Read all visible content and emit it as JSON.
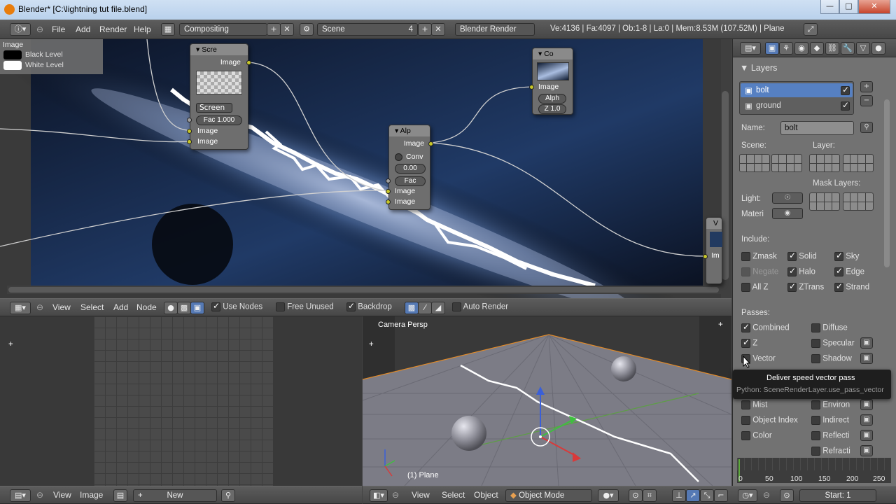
{
  "window": {
    "title": "Blender* [C:\\lightning tut file.blend]",
    "minimize": "—",
    "maximize": "□",
    "close": "✕"
  },
  "info_header": {
    "menus": [
      "File",
      "Add",
      "Render",
      "Help"
    ],
    "screen_layout": "Compositing",
    "scene": "Scene",
    "scene_users": "4",
    "render_engine": "Blender Render",
    "stats": "Ve:4136 | Fa:4097 | Ob:1-8 | La:0 | Mem:8.53M (107.52M) | Plane"
  },
  "node_editor": {
    "legend": {
      "title": "Image",
      "black_level": "Black Level",
      "white_level": "White Level"
    },
    "screen_node": {
      "title": "Scre",
      "output": "Image",
      "blend_mode": "Screen",
      "fac": "Fac 1.000",
      "in1": "Image",
      "in2": "Image"
    },
    "alpha_node": {
      "title": "Alp",
      "output": "Image",
      "conv": "Conv",
      "value": "0.00",
      "fac": "Fac",
      "in1": "Image",
      "in2": "Image"
    },
    "composite_node": {
      "title": "Co",
      "in_image": "Image",
      "alpha": "Alph",
      "z": "Z 1.0"
    },
    "viewer_node": {
      "title": "V",
      "in_image": "Im"
    }
  },
  "node_header": {
    "menus": [
      "View",
      "Select",
      "Add",
      "Node"
    ],
    "use_nodes": "Use Nodes",
    "free_unused": "Free Unused",
    "backdrop": "Backdrop",
    "auto_render": "Auto Render"
  },
  "image_header": {
    "menus": [
      "View",
      "Image"
    ],
    "new_button": "New"
  },
  "viewport": {
    "label": "Camera Persp",
    "object_label": "(1) Plane",
    "menus": [
      "View",
      "Select",
      "Object"
    ],
    "mode": "Object Mode"
  },
  "properties": {
    "panel_title": "Layers",
    "layers": [
      {
        "name": "bolt",
        "checked": true,
        "selected": true
      },
      {
        "name": "ground",
        "checked": true,
        "selected": false
      }
    ],
    "name_label": "Name:",
    "name_value": "bolt",
    "scene_label": "Scene:",
    "layer_label": "Layer:",
    "mask_layers_label": "Mask Layers:",
    "light_label": "Light:",
    "material_label": "Materi",
    "include_label": "Include:",
    "include": [
      {
        "label": "Zmask",
        "on": false
      },
      {
        "label": "Solid",
        "on": true
      },
      {
        "label": "Sky",
        "on": true
      },
      {
        "label": "Negate",
        "on": false
      },
      {
        "label": "Halo",
        "on": true
      },
      {
        "label": "Edge",
        "on": true
      },
      {
        "label": "All Z",
        "on": false
      },
      {
        "label": "ZTrans",
        "on": true
      },
      {
        "label": "Strand",
        "on": true
      }
    ],
    "passes_label": "Passes:",
    "passes_left": [
      {
        "label": "Combined",
        "on": true
      },
      {
        "label": "Z",
        "on": true
      },
      {
        "label": "Vector",
        "on": false
      },
      {
        "label": "Mist",
        "on": false
      },
      {
        "label": "Object Index",
        "on": false
      },
      {
        "label": "Color",
        "on": false
      }
    ],
    "passes_right": [
      {
        "label": "Diffuse",
        "on": false
      },
      {
        "label": "Specular",
        "on": false
      },
      {
        "label": "Shadow",
        "on": false
      },
      {
        "label": "Environ",
        "on": false
      },
      {
        "label": "Indirect",
        "on": false
      },
      {
        "label": "Reflecti",
        "on": false
      },
      {
        "label": "Refracti",
        "on": false
      }
    ],
    "tooltip_title": "Deliver speed vector pass",
    "tooltip_python": "Python: SceneRenderLayer.use_pass_vector"
  },
  "timeline": {
    "ticks": [
      "0",
      "50",
      "100",
      "150",
      "200",
      "250"
    ],
    "start": "Start: 1"
  }
}
